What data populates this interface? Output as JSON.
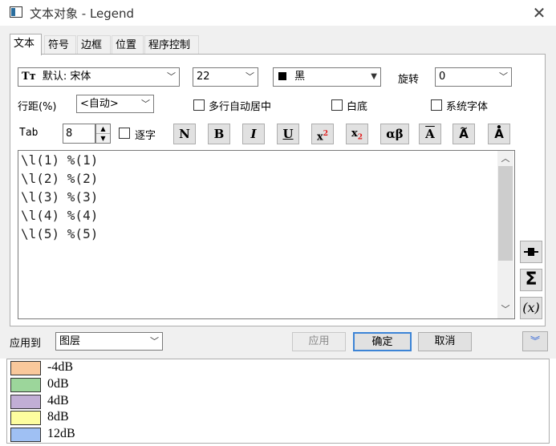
{
  "window": {
    "title": "文本对象 - Legend",
    "close_glyph": "✕"
  },
  "tabs": [
    {
      "label": "文本",
      "active": true
    },
    {
      "label": "符号",
      "active": false
    },
    {
      "label": "边框",
      "active": false
    },
    {
      "label": "位置",
      "active": false
    },
    {
      "label": "程序控制",
      "active": false
    }
  ],
  "font": {
    "icon_glyph": "Tт",
    "value": "默认: 宋体"
  },
  "size": {
    "value": "22"
  },
  "color": {
    "swatch_color": "#000000",
    "value": "黑"
  },
  "rotation": {
    "label": "旋转",
    "value": "0"
  },
  "line_spacing": {
    "label": "行距(%)",
    "value": "<自动>"
  },
  "options": {
    "multiline_center": "多行自动居中",
    "white_background": "白底",
    "system_font": "系统字体"
  },
  "tab_setting": {
    "label": "Tab",
    "value": "8"
  },
  "per_char": {
    "label": "逐字"
  },
  "format_buttons": {
    "normal": "N",
    "bold": "B",
    "italic": "I",
    "underline": "U",
    "superscript_base": "x",
    "superscript_exp": "2",
    "subscript_base": "x",
    "subscript_exp": "2",
    "greek": "αβ",
    "overbar": "A",
    "tilde": "A",
    "dot": "A"
  },
  "editor": {
    "lines": [
      "\\l(1) %(1)",
      "\\l(2) %(2)",
      "\\l(3) %(3)",
      "\\l(4) %(4)",
      "\\l(5) %(5)"
    ]
  },
  "side_buttons": {
    "sigma": "Σ",
    "variable": "(x)"
  },
  "apply_to": {
    "label": "应用到",
    "value": "图层"
  },
  "buttons": {
    "apply": "应用",
    "ok": "确定",
    "cancel": "取消"
  },
  "legend": [
    {
      "label": "-4dB",
      "color": "#f9c89b"
    },
    {
      "label": "0dB",
      "color": "#9cd69b"
    },
    {
      "label": "4dB",
      "color": "#c1aed5"
    },
    {
      "label": "8dB",
      "color": "#fdfd9f"
    },
    {
      "label": "12dB",
      "color": "#9fc0f3"
    }
  ]
}
